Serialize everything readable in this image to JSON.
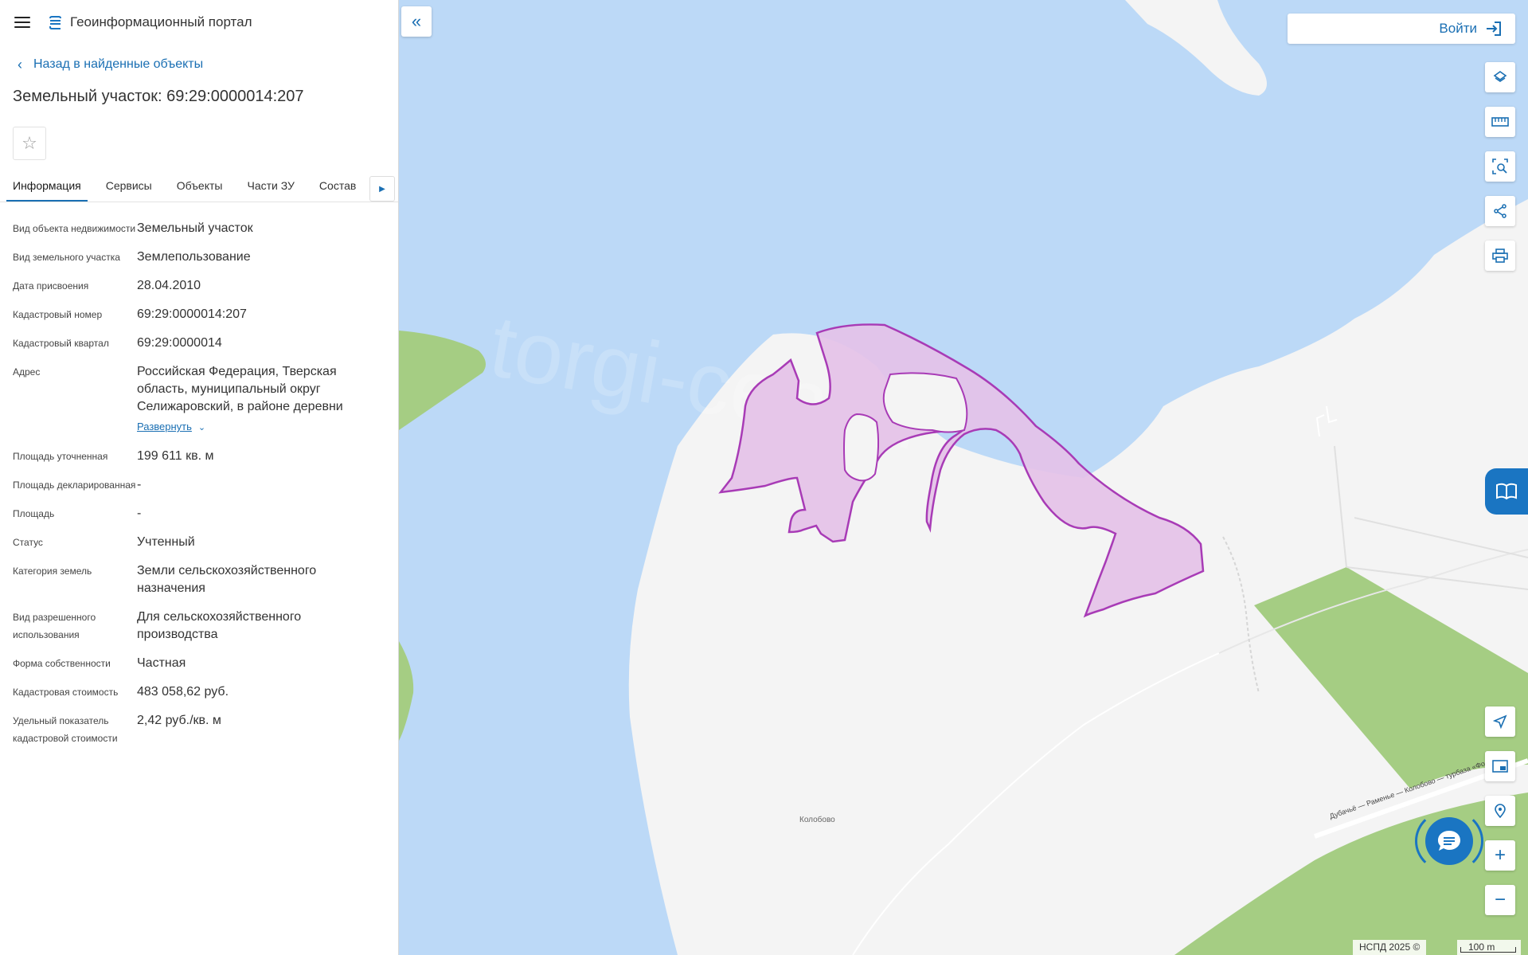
{
  "header": {
    "title": "Геоинформационный портал"
  },
  "back_link": "Назад в найденные объекты",
  "object_title": "Земельный участок: 69:29:0000014:207",
  "tabs": [
    {
      "label": "Информация",
      "active": true
    },
    {
      "label": "Сервисы"
    },
    {
      "label": "Объекты"
    },
    {
      "label": "Части ЗУ"
    },
    {
      "label": "Состав"
    }
  ],
  "info": [
    {
      "label": "Вид объекта недвижимости",
      "value": "Земельный участок"
    },
    {
      "label": "Вид земельного участка",
      "value": "Землепользование"
    },
    {
      "label": "Дата присвоения",
      "value": "28.04.2010"
    },
    {
      "label": "Кадастровый номер",
      "value": "69:29:0000014:207"
    },
    {
      "label": "Кадастровый квартал",
      "value": "69:29:0000014"
    },
    {
      "label": "Адрес",
      "value": "Российская Федерация, Тверская область, муниципальный округ Селижаровский, в районе деревни",
      "expand": "Развернуть"
    },
    {
      "label": "Площадь уточненная",
      "value": "199 611 кв. м"
    },
    {
      "label": "Площадь декларированная",
      "value": "-"
    },
    {
      "label": "Площадь",
      "value": "-"
    },
    {
      "label": "Статус",
      "value": "Учтенный"
    },
    {
      "label": "Категория земель",
      "value": "Земли сельскохозяйственного назначения"
    },
    {
      "label": "Вид разрешенного использования",
      "value": "Для сельскохозяйственного производства"
    },
    {
      "label": "Форма собственности",
      "value": "Частная"
    },
    {
      "label": "Кадастровая стоимость",
      "value": "483 058,62 руб."
    },
    {
      "label": "Удельный показатель кадастровой стоимости",
      "value": "2,42 руб./кв. м"
    }
  ],
  "map": {
    "login_label": "Войти",
    "place_label": "Колобово",
    "road_label": "Дубачьё — Раменье — Колобово — турбаза «Фост»",
    "copyright": "НСПД 2025 ©",
    "scale_label": "100 m",
    "colors": {
      "water": "#bcd9f7",
      "land": "#f4f4f4",
      "forest": "#a5cd83",
      "parcel_fill": "#e4c1e8",
      "parcel_stroke": "#a83bb6",
      "accent": "#1a75c2"
    }
  },
  "map_tools": [
    "layers-icon",
    "ruler-icon",
    "area-search-icon",
    "share-icon",
    "print-icon",
    "locate-icon",
    "minimap-icon",
    "geo-search-icon",
    "zoom-in-icon",
    "zoom-out-icon"
  ]
}
